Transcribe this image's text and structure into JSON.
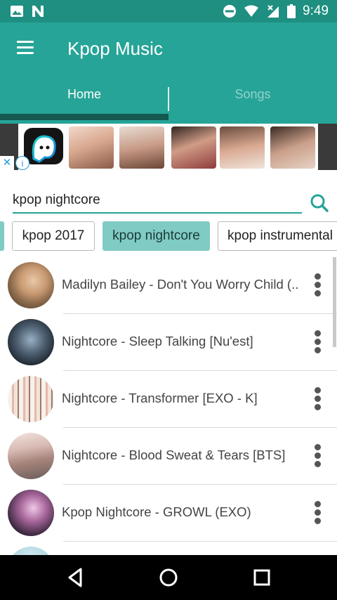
{
  "status_bar": {
    "time": "9:49",
    "icons": [
      "image-icon",
      "n-app-icon",
      "do-not-disturb-icon",
      "wifi-icon",
      "signal-icon",
      "battery-icon"
    ]
  },
  "app_bar": {
    "title": "Kpop Music",
    "tabs": [
      {
        "label": "Home",
        "selected": true
      },
      {
        "label": "Songs",
        "selected": false
      }
    ],
    "colors": {
      "primary": "#26a497",
      "status": "#1e8f80",
      "indicator": "#14584f"
    }
  },
  "ad": {
    "close_glyph": "✕",
    "info_glyph": "i"
  },
  "search": {
    "value": "kpop nightcore",
    "placeholder": ""
  },
  "chips": [
    {
      "label": "kpop 2017",
      "selected": false
    },
    {
      "label": "kpop nightcore",
      "selected": true
    },
    {
      "label": "kpop instrumental",
      "selected": false
    }
  ],
  "songs": [
    {
      "title": "Madilyn Bailey - Don't You Worry Child (..."
    },
    {
      "title": "Nightcore - Sleep Talking [Nu'est]"
    },
    {
      "title": "Nightcore - Transformer [EXO - K]"
    },
    {
      "title": "Nightcore - Blood Sweat & Tears [BTS]"
    },
    {
      "title": "Kpop Nightcore - GROWL (EXO)"
    }
  ],
  "nav": {
    "buttons": [
      "back-icon",
      "home-icon",
      "recents-icon"
    ]
  }
}
